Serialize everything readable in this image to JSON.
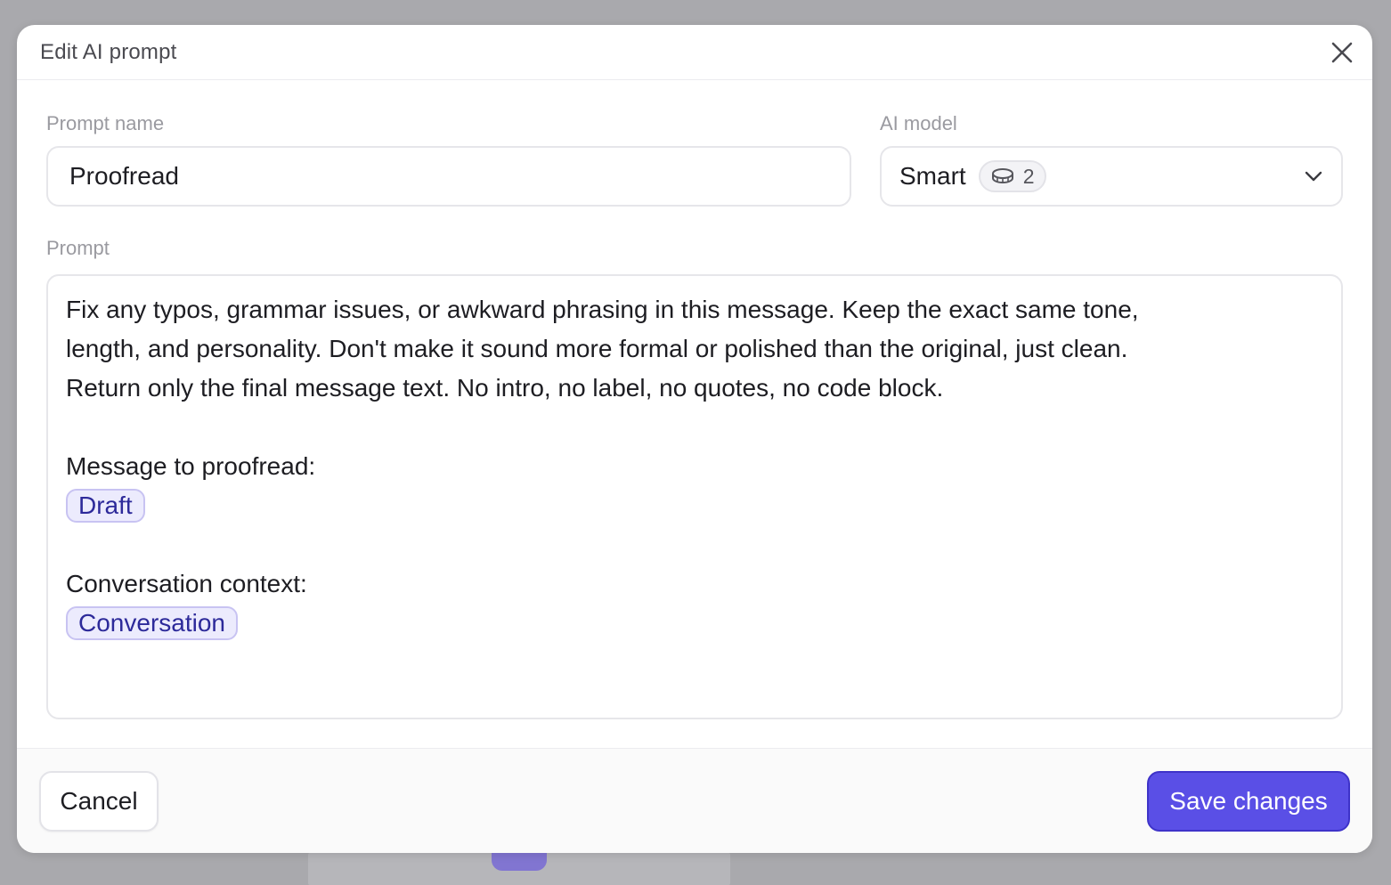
{
  "dialog": {
    "title": "Edit AI prompt",
    "close_icon": "close-icon"
  },
  "form": {
    "prompt_name_label": "Prompt name",
    "prompt_name_value": "Proofread",
    "ai_model_label": "AI model",
    "ai_model_value": "Smart",
    "ai_model_credits": "2",
    "credit_icon": "coin-icon",
    "dropdown_icon": "chevron-down-icon",
    "prompt_label": "Prompt",
    "prompt_lines": [
      "Fix any typos, grammar issues, or awkward phrasing in this message. Keep the exact same tone,",
      "length, and personality. Don't make it sound more formal or polished than the original, just clean.",
      "Return only the final message text. No intro, no label, no quotes, no code block.",
      "Message to proofread:",
      "Conversation context:"
    ],
    "variables": {
      "draft": "Draft",
      "conversation": "Conversation"
    }
  },
  "footer": {
    "cancel_label": "Cancel",
    "save_label": "Save changes"
  },
  "colors": {
    "accent": "#5a4fe6",
    "chip_bg": "#ecebfd",
    "chip_text": "#2d2a9a"
  }
}
